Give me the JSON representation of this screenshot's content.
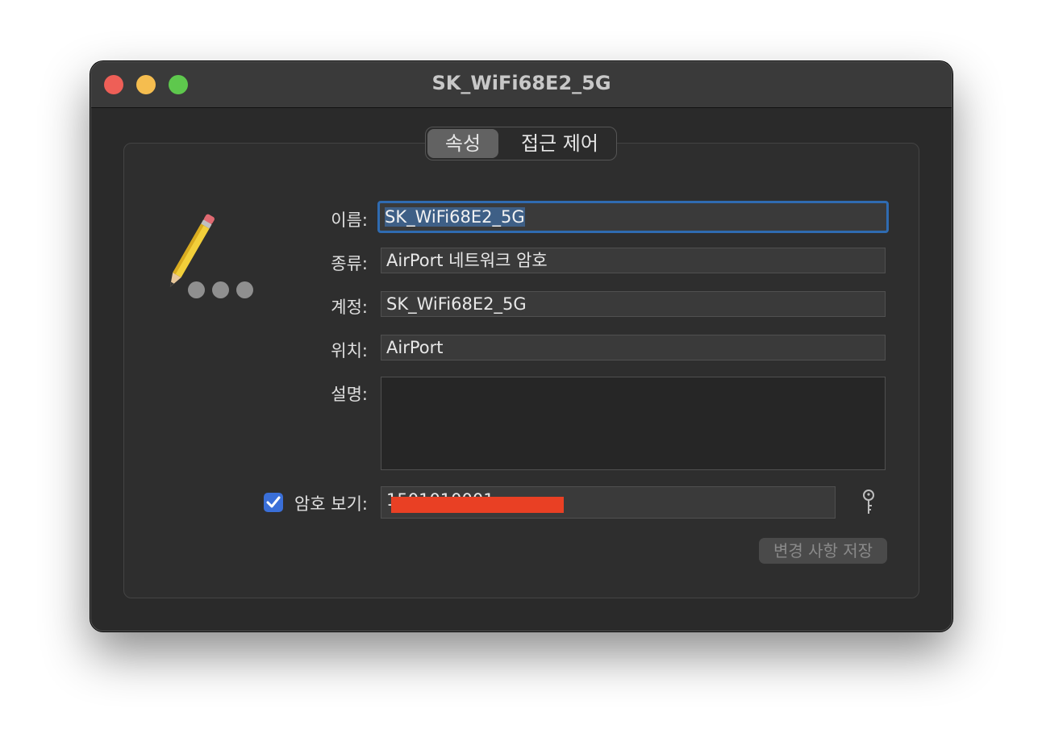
{
  "window": {
    "title": "SK_WiFi68E2_5G"
  },
  "tabs": [
    {
      "label": "속성",
      "selected": true
    },
    {
      "label": "접근 제어",
      "selected": false
    }
  ],
  "form": {
    "name_label": "이름:",
    "name_value": "SK_WiFi68E2_5G",
    "kind_label": "종류:",
    "kind_value": "AirPort 네트워크 암호",
    "account_label": "계정:",
    "account_value": "SK_WiFi68E2_5G",
    "where_label": "위치:",
    "where_value": "AirPort",
    "comments_label": "설명:",
    "comments_value": "",
    "show_password_label": "암호 보기:",
    "show_password_checked": true,
    "password_value": "1501010001"
  },
  "buttons": {
    "save_label": "변경 사항 저장"
  },
  "colors": {
    "accent": "#3a6fd8",
    "focus_ring": "#2f6bb1",
    "redaction": "#e94024"
  }
}
